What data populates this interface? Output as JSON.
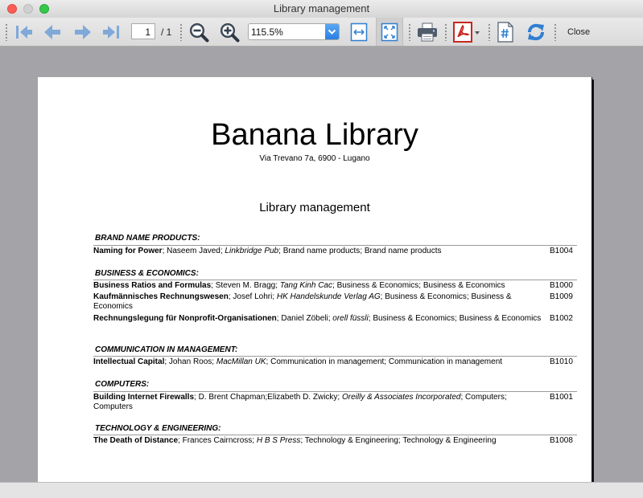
{
  "window": {
    "title": "Library management"
  },
  "toolbar": {
    "page_current": "1",
    "page_total": "/ 1",
    "zoom_value": "115.5%",
    "close_label": "Close",
    "icons": [
      "first-page-icon",
      "previous-page-icon",
      "next-page-icon",
      "last-page-icon",
      "zoom-out-icon",
      "zoom-in-icon",
      "fit-width-icon",
      "fit-page-icon",
      "print-icon",
      "pdf-export-icon",
      "page-number-icon",
      "refresh-icon"
    ]
  },
  "document": {
    "library_name": "Banana Library",
    "address": "Via Trevano 7a, 6900 - Lugano",
    "report_title": "Library management",
    "categories": [
      {
        "name": "BRAND NAME PRODUCTS:",
        "entries": [
          {
            "title": "Naming for Power",
            "author": "Naseem Javed",
            "publisher": "Linkbridge Pub",
            "subject": "Brand name products",
            "subject2": "Brand name products",
            "code": "B1004"
          }
        ]
      },
      {
        "name": "BUSINESS & ECONOMICS:",
        "entries": [
          {
            "title": "Business Ratios and Formulas",
            "author": "Steven M. Bragg",
            "publisher": "Tang Kinh Cac",
            "subject": "Business & Economics",
            "subject2": "Business & Economics",
            "code": "B1000"
          },
          {
            "title": "Kaufmännisches Rechnungswesen",
            "author": "Josef Lohri",
            "publisher": "HK Handelskunde Verlag AG",
            "subject": "Business & Economics",
            "subject2": "Business & Economics",
            "code": "B1009"
          },
          {
            "title": "Rechnungslegung für Nonprofit-Organisationen",
            "author": "Daniel Zöbeli",
            "publisher": "orell füssli",
            "subject": "Business & Economics",
            "subject2": "Business & Economics",
            "code": "B1002"
          }
        ]
      },
      {
        "name": "COMMUNICATION IN MANAGEMENT:",
        "entries": [
          {
            "title": "Intellectual Capital",
            "author": "Johan Roos",
            "publisher": "MacMillan UK",
            "subject": "Communication in management",
            "subject2": "Communication in management",
            "code": "B1010"
          }
        ]
      },
      {
        "name": "COMPUTERS:",
        "entries": [
          {
            "title": "Building Internet Firewalls",
            "author": "D. Brent Chapman;Elizabeth D. Zwicky",
            "publisher": "Oreilly & Associates Incorporated",
            "subject": "Computers",
            "subject2": "Computers",
            "code": "B1001"
          }
        ]
      },
      {
        "name": "TECHNOLOGY & ENGINEERING:",
        "entries": [
          {
            "title": "The Death of Distance",
            "author": "Frances Cairncross",
            "publisher": "H B S Press",
            "subject": "Technology & Engineering",
            "subject2": "Technology & Engineering",
            "code": "B1008"
          }
        ]
      }
    ]
  }
}
